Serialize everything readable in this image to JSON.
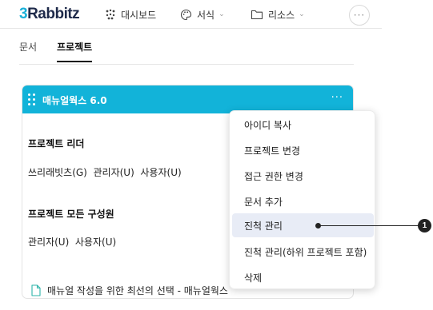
{
  "app": {
    "logo_number": "3",
    "logo_text": "Rabbitz"
  },
  "nav": {
    "dashboard": "대시보드",
    "format": "서식",
    "resources": "리소스",
    "more": "···"
  },
  "tabs": [
    {
      "label": "문서"
    },
    {
      "label": "프로젝트"
    }
  ],
  "card": {
    "title": "매뉴얼웍스 6.0",
    "more": "···",
    "leader_label": "프로젝트 리더",
    "leader_value": "쓰리래빗츠(G)  관리자(U)  사용자(U)",
    "members_label": "프로젝트 모든 구성원",
    "members_value": "관리자(U)  사용자(U)",
    "document": "매뉴얼 작성을 위한 최선의 선택 - 매뉴얼웍스"
  },
  "menu": {
    "items": [
      {
        "label": "아이디 복사"
      },
      {
        "label": "프로젝트 변경"
      },
      {
        "label": "접근 권한 변경"
      },
      {
        "label": "문서 추가"
      },
      {
        "label": "진척 관리"
      },
      {
        "label": "진척 관리(하위 프로젝트 포함)"
      },
      {
        "label": "삭제"
      }
    ],
    "highlighted_item": "진척 관리"
  },
  "callout": {
    "number": "1"
  },
  "colors": {
    "accent": "#12b3d9",
    "highlight": "#e8ecf6",
    "logo_dark": "#1e2a4a"
  }
}
